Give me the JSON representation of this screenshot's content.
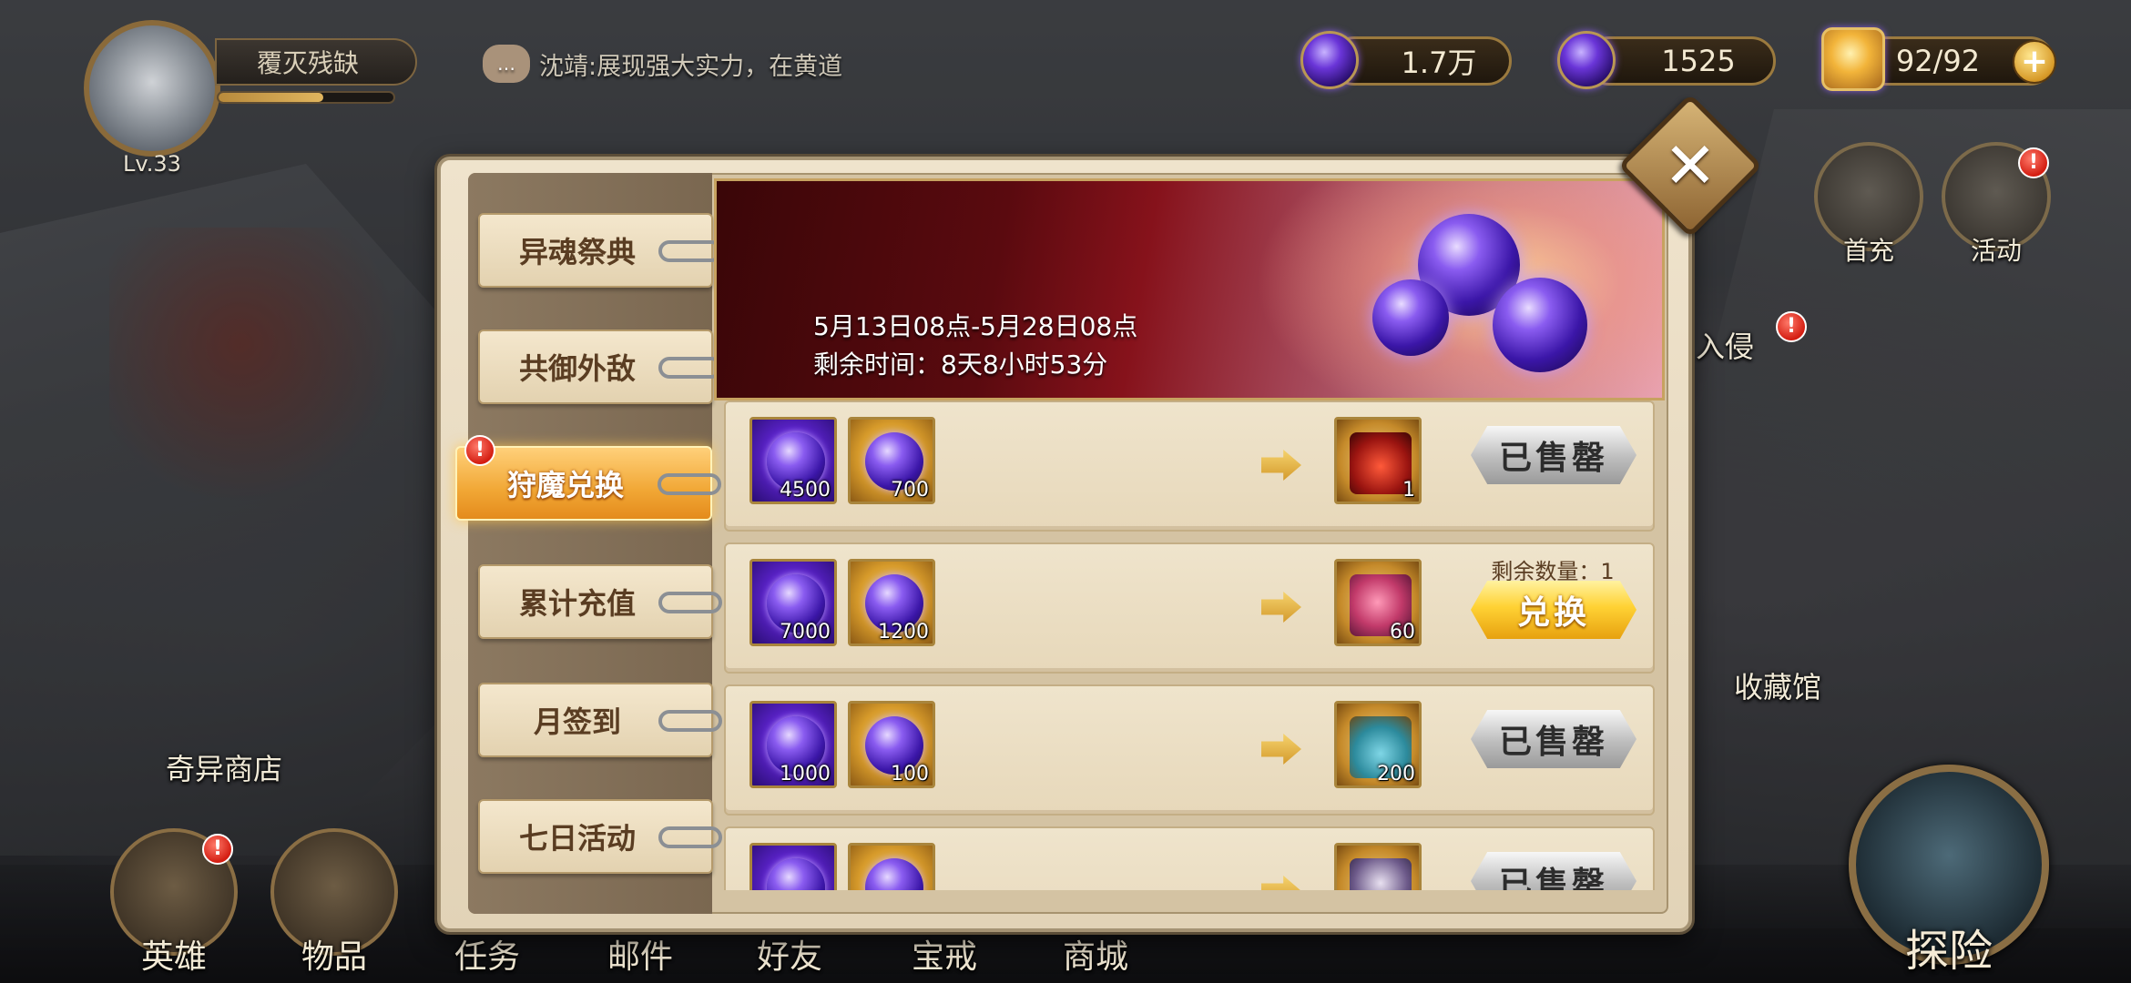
{
  "player": {
    "level": "Lv.33",
    "name": "覆灭残缺"
  },
  "chat": {
    "message": "沈靖:展现强大实力，在黄道"
  },
  "currencies": [
    {
      "icon": "purple-orb-crescent-icon",
      "value": "1.7万"
    },
    {
      "icon": "purple-orb-icon",
      "value": "1525"
    },
    {
      "icon": "stamina-icon",
      "value": "92/92"
    }
  ],
  "side_buttons": {
    "first_recharge": "首充",
    "activity": "活动"
  },
  "map_labels": {
    "invasion": "入侵",
    "shop": "奇异商店",
    "collection": "收藏馆"
  },
  "bottom_nav": [
    {
      "label": "英雄",
      "icon": "helmet-icon"
    },
    {
      "label": "物品",
      "icon": "bag-icon"
    },
    {
      "label": "任务",
      "icon": "quest-icon"
    },
    {
      "label": "邮件",
      "icon": "mail-icon"
    },
    {
      "label": "好友",
      "icon": "friends-icon"
    },
    {
      "label": "宝戒",
      "icon": "ring-icon"
    },
    {
      "label": "商城",
      "icon": "store-icon"
    }
  ],
  "explore": {
    "label": "探险"
  },
  "modal": {
    "tabs": [
      {
        "label": "异魂祭典",
        "active": false
      },
      {
        "label": "共御外敌",
        "active": false
      },
      {
        "label": "狩魔兑换",
        "active": true
      },
      {
        "label": "累计充值",
        "active": false
      },
      {
        "label": "月签到",
        "active": false
      },
      {
        "label": "七日活动",
        "active": false
      }
    ],
    "banner": {
      "date_range": "5月13日08点-5月28日08点",
      "remaining": "剩余时间：8天8小时53分"
    },
    "rows": [
      {
        "cost1": "4500",
        "cost2": "700",
        "reward_qty": "1",
        "reward_icon": "red-chest-icon",
        "button": "已售罄",
        "status": "sold"
      },
      {
        "cost1": "7000",
        "cost2": "1200",
        "reward_qty": "60",
        "reward_icon": "dragon-shard-icon",
        "button": "兑换",
        "status": "available",
        "remaining": "剩余数量：1"
      },
      {
        "cost1": "1000",
        "cost2": "100",
        "reward_qty": "200",
        "reward_icon": "potion-icon",
        "button": "已售罄",
        "status": "sold"
      },
      {
        "cost1": "",
        "cost2": "",
        "reward_qty": "",
        "reward_icon": "hero-portrait-icon",
        "button": "已售罄",
        "status": "sold"
      }
    ]
  },
  "colors": {
    "tab_active": "#f1a735",
    "exchange_button": "#ffd234",
    "sold_button": "#bdbdbd",
    "alert": "#d41e12"
  }
}
